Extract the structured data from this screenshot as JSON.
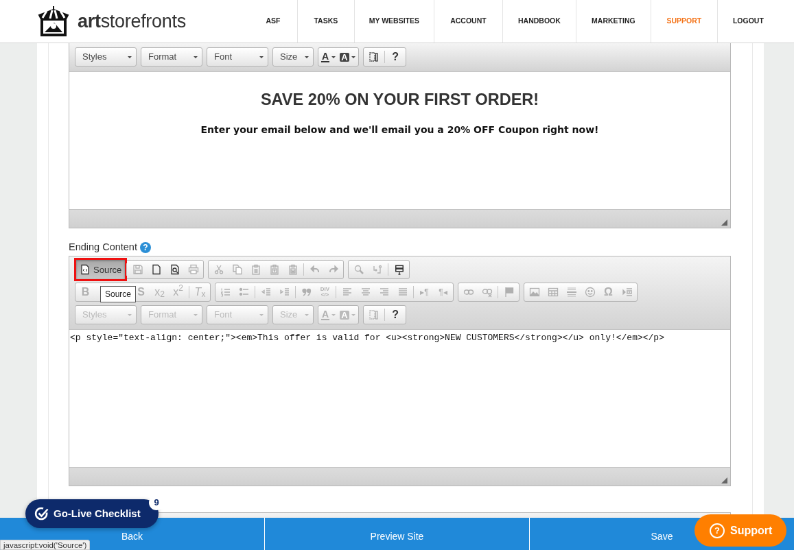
{
  "header": {
    "logo_text": "**art**storefronts",
    "nav": [
      {
        "label": "ASF",
        "selected": false
      },
      {
        "label": "TASKS",
        "selected": false
      },
      {
        "label": "MY WEBSITES",
        "selected": false
      },
      {
        "label": "ACCOUNT",
        "selected": false
      },
      {
        "label": "HANDBOOK",
        "selected": false
      },
      {
        "label": "MARKETING",
        "selected": false
      },
      {
        "label": "SUPPORT",
        "selected": true
      },
      {
        "label": "LOGOUT",
        "selected": false
      }
    ]
  },
  "editors": [
    {
      "toolbar": [
        [
          [
            {
              "kind": "combo",
              "label": "Styles",
              "disabled": false
            },
            {
              "kind": "combo",
              "label": "Format",
              "disabled": false
            },
            {
              "kind": "combo",
              "label": "Font",
              "disabled": false
            },
            {
              "kind": "combo",
              "label": "Size",
              "disabled": false
            }
          ],
          [
            {
              "kind": "color-text",
              "label": "A",
              "disabled": false
            },
            {
              "kind": "color-bg",
              "label": "A",
              "disabled": false
            }
          ],
          [
            {
              "kind": "icon",
              "disabled": false
            },
            {
              "kind": "separator"
            },
            {
              "kind": "glyph",
              "label": "?",
              "disabled": false
            }
          ]
        ]
      ],
      "content": {
        "kind": "wysiwyg",
        "heading": "SAVE 20% ON YOUR FIRST ORDER!",
        "paragraph": "Enter your email below and we'll email you a 20% OFF Coupon right now!"
      }
    },
    {
      "label": "Ending Content",
      "help": "?",
      "tooltip": "Source",
      "toolbar": [
        [
          [
            {
              "kind": "text-button",
              "label": "Source",
              "selected": true,
              "annotated": true
            },
            {
              "kind": "separator"
            },
            {
              "kind": "icon",
              "disabled": true
            },
            {
              "kind": "icon",
              "disabled": false
            },
            {
              "kind": "icon",
              "disabled": false
            },
            {
              "kind": "icon",
              "disabled": true
            }
          ],
          [
            {
              "kind": "icon",
              "disabled": true
            },
            {
              "kind": "icon",
              "disabled": true
            },
            {
              "kind": "icon",
              "disabled": true
            },
            {
              "kind": "icon",
              "disabled": true
            },
            {
              "kind": "icon",
              "disabled": true
            },
            {
              "kind": "separator"
            },
            {
              "kind": "icon",
              "disabled": true
            },
            {
              "kind": "icon",
              "disabled": true
            }
          ],
          [
            {
              "kind": "icon",
              "disabled": true
            },
            {
              "kind": "icon",
              "disabled": true
            },
            {
              "kind": "separator"
            },
            {
              "kind": "icon",
              "disabled": false
            }
          ]
        ],
        [
          [
            {
              "kind": "glyph",
              "label": "**B**",
              "disabled": true
            },
            {
              "kind": "covered"
            },
            {
              "kind": "covered"
            },
            {
              "kind": "glyph",
              "label": "S",
              "disabled": true
            },
            {
              "kind": "glyph",
              "label": "x$_{2}$",
              "disabled": true
            },
            {
              "kind": "glyph",
              "label": "x$^{2}$",
              "disabled": true
            },
            {
              "kind": "separator"
            },
            {
              "kind": "glyph",
              "label": "*T*$_{x}$",
              "disabled": true
            }
          ],
          [
            {
              "kind": "icon",
              "disabled": true
            },
            {
              "kind": "icon",
              "disabled": true
            },
            {
              "kind": "separator"
            },
            {
              "kind": "icon",
              "disabled": true
            },
            {
              "kind": "icon",
              "disabled": true
            },
            {
              "kind": "separator"
            },
            {
              "kind": "icon",
              "disabled": true
            },
            {
              "kind": "glyph-stack",
              "label": "DIV",
              "sublabel": "</>",
              "disabled": true
            },
            {
              "kind": "separator"
            },
            {
              "kind": "icon",
              "disabled": true
            },
            {
              "kind": "icon",
              "disabled": true
            },
            {
              "kind": "icon",
              "disabled": true
            },
            {
              "kind": "icon",
              "disabled": true
            },
            {
              "kind": "separator"
            },
            {
              "kind": "glyph",
              "label": "▸¶",
              "disabled": true
            },
            {
              "kind": "glyph",
              "label": "¶◂",
              "disabled": true
            }
          ],
          [
            {
              "kind": "icon",
              "disabled": true
            },
            {
              "kind": "icon",
              "disabled": true
            },
            {
              "kind": "separator"
            },
            {
              "kind": "icon",
              "disabled": true
            }
          ],
          [
            {
              "kind": "icon",
              "disabled": true
            },
            {
              "kind": "icon",
              "disabled": true
            },
            {
              "kind": "icon",
              "disabled": true
            },
            {
              "kind": "icon",
              "disabled": true
            },
            {
              "kind": "glyph",
              "label": "Ω",
              "disabled": true
            },
            {
              "kind": "icon",
              "disabled": true
            }
          ]
        ],
        [
          [
            {
              "kind": "combo",
              "label": "Styles",
              "disabled": true
            },
            {
              "kind": "combo",
              "label": "Format",
              "disabled": true
            },
            {
              "kind": "combo",
              "label": "Font",
              "disabled": true
            },
            {
              "kind": "combo",
              "label": "Size",
              "disabled": true
            }
          ],
          [
            {
              "kind": "color-text",
              "label": "A",
              "disabled": true
            },
            {
              "kind": "color-bg",
              "label": "A",
              "disabled": true
            }
          ],
          [
            {
              "kind": "icon",
              "disabled": true
            },
            {
              "kind": "separator"
            },
            {
              "kind": "glyph",
              "label": "?",
              "disabled": false
            }
          ]
        ]
      ],
      "content": {
        "kind": "source",
        "value": "<p style=\"text-align: center;\"><em>This offer is valid for <u><strong>NEW CUSTOMERS</strong></u> only!</em></p>"
      }
    }
  ],
  "footer": {
    "buttons": [
      "Back",
      "Preview Site",
      "Save"
    ]
  },
  "checklist": {
    "label": "Go-Live Checklist",
    "count": "9"
  },
  "support": {
    "icon": "?",
    "label": "Support"
  },
  "status_url": "javascript:void('Source')"
}
